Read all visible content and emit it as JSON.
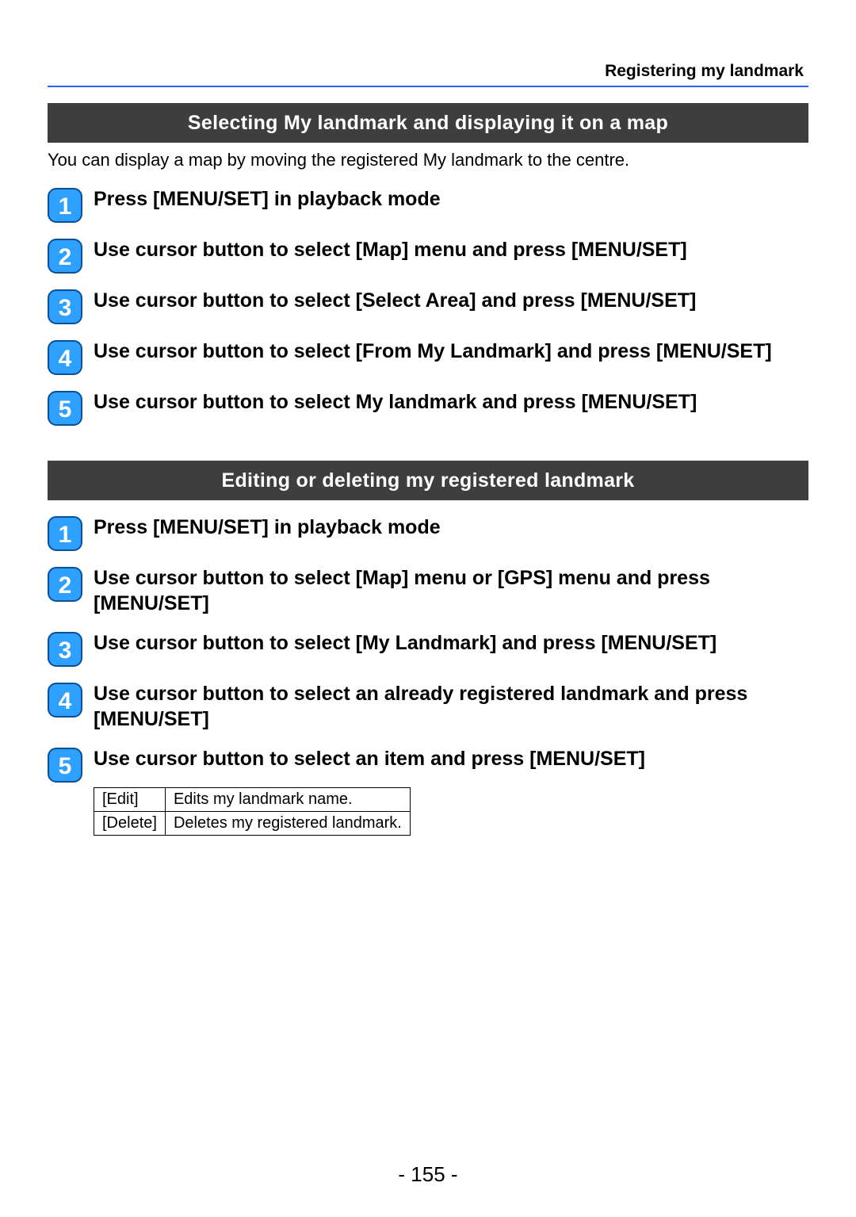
{
  "header": {
    "breadcrumb": "Registering my landmark"
  },
  "section1": {
    "title": "Selecting My landmark and displaying it on a map",
    "intro": "You can display a map by moving the registered My landmark to the centre.",
    "steps": [
      "Press [MENU/SET] in playback mode",
      "Use cursor button to select [Map] menu and press [MENU/SET]",
      "Use cursor button to select [Select Area] and press [MENU/SET]",
      "Use cursor button to select [From My Landmark] and press [MENU/SET]",
      "Use cursor button to select My landmark and press [MENU/SET]"
    ]
  },
  "section2": {
    "title": "Editing or deleting my registered landmark",
    "steps": [
      "Press [MENU/SET] in playback mode",
      "Use cursor button to select [Map] menu or [GPS] menu and press [MENU/SET]",
      "Use cursor button to select [My Landmark] and press [MENU/SET]",
      "Use cursor button to select an already registered landmark and press [MENU/SET]",
      "Use cursor button to select an item and press [MENU/SET]"
    ],
    "options": [
      {
        "label": "[Edit]",
        "desc": "Edits my landmark name."
      },
      {
        "label": "[Delete]",
        "desc": "Deletes my registered landmark."
      }
    ]
  },
  "page_number": "- 155 -"
}
